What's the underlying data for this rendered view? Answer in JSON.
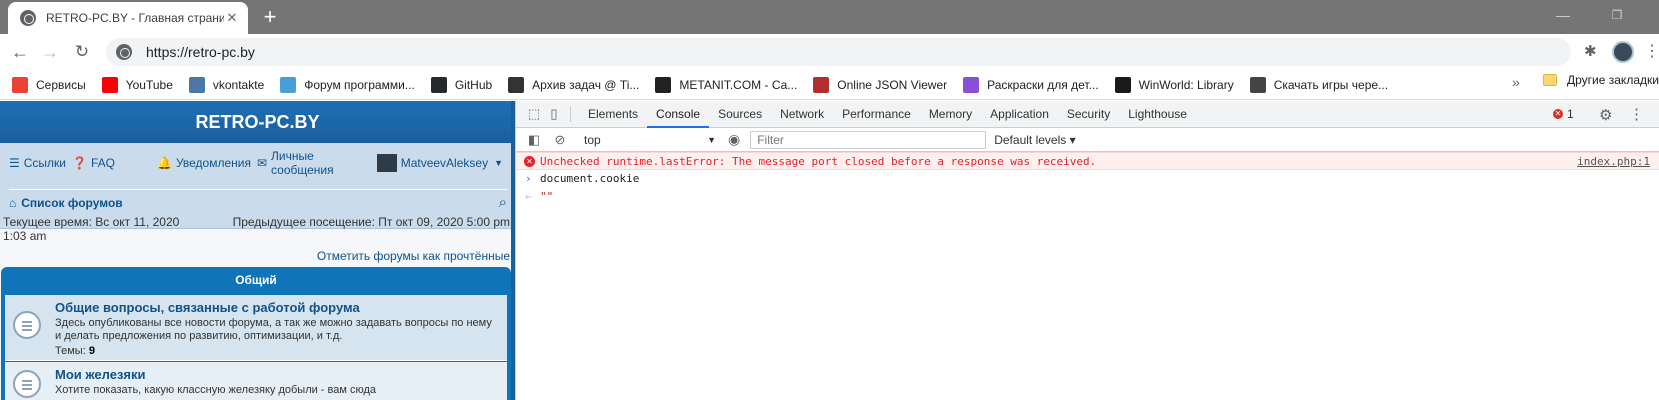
{
  "browser": {
    "tab_title": "RETRO-PC.BY - Главная страниц",
    "url": "https://retro-pc.by"
  },
  "bookmarks": [
    {
      "label": "Сервисы",
      "icon": "apps-grid-icon",
      "color": "#ea4335"
    },
    {
      "label": "YouTube",
      "icon": "youtube-icon",
      "color": "#ff0000"
    },
    {
      "label": "vkontakte",
      "icon": "vk-icon",
      "color": "#4a76a8"
    },
    {
      "label": "Форум программи...",
      "icon": "forum-icon",
      "color": "#4a9fd8"
    },
    {
      "label": "GitHub",
      "icon": "github-icon",
      "color": "#24292e"
    },
    {
      "label": "Архив задач @ Ti...",
      "icon": "timus-icon",
      "color": "#333333"
    },
    {
      "label": "METANIT.COM - Са...",
      "icon": "metanit-icon",
      "color": "#222222"
    },
    {
      "label": "Online JSON Viewer",
      "icon": "json-viewer-icon",
      "color": "#b03030"
    },
    {
      "label": "Раскраски для дет...",
      "icon": "coloring-icon",
      "color": "#8a4fd8"
    },
    {
      "label": "WinWorld: Library",
      "icon": "winworld-icon",
      "color": "#1a1a1a"
    },
    {
      "label": "Скачать игры чере...",
      "icon": "download-games-icon",
      "color": "#444444"
    }
  ],
  "bookmarks_more": "»",
  "other_bookmarks": "Другие закладки",
  "forum": {
    "site_title": "RETRO-PC.BY",
    "nav": {
      "links": "Ссылки",
      "faq": "FAQ",
      "notifications": "Уведомления",
      "messages": "Личные сообщения",
      "username": "MatveevAleksey"
    },
    "breadcrumb": "Список форумов",
    "current_time": "Текущее время: Вс окт 11, 2020 1:03 am",
    "previous_visit": "Предыдущее посещение: Пт окт 09, 2020 5:00 pm",
    "mark_read": "Отметить форумы как прочтённые",
    "category": "Общий",
    "forums": [
      {
        "name": "Общие вопросы, связанные с работой форума",
        "description": "Здесь опубликованы все новости форума, а так же можно задавать вопросы по нему и делать предложения по развитию, оптимизации, и т.д.",
        "topics_label": "Темы:",
        "topics_count": "9"
      },
      {
        "name": "Мои железяки",
        "description": "Хотите показать, какую классную железяку добыли - вам сюда"
      }
    ]
  },
  "devtools": {
    "tabs": [
      "Elements",
      "Console",
      "Sources",
      "Network",
      "Performance",
      "Memory",
      "Application",
      "Security",
      "Lighthouse"
    ],
    "active_tab": "Console",
    "error_count": "1",
    "context": "top",
    "filter_placeholder": "Filter",
    "levels": "Default levels",
    "console": {
      "error_text": "Unchecked runtime.lastError: The message port closed before a response was received.",
      "error_source": "index.php:1",
      "input_text": "document.cookie",
      "result_text": "\"\""
    }
  },
  "colors": {
    "forum_header": "#1a5f9e",
    "forum_nav": "#cadceb",
    "forum_link": "#105289",
    "devtools_active": "#1a73e8",
    "console_error": "#e8202a"
  }
}
